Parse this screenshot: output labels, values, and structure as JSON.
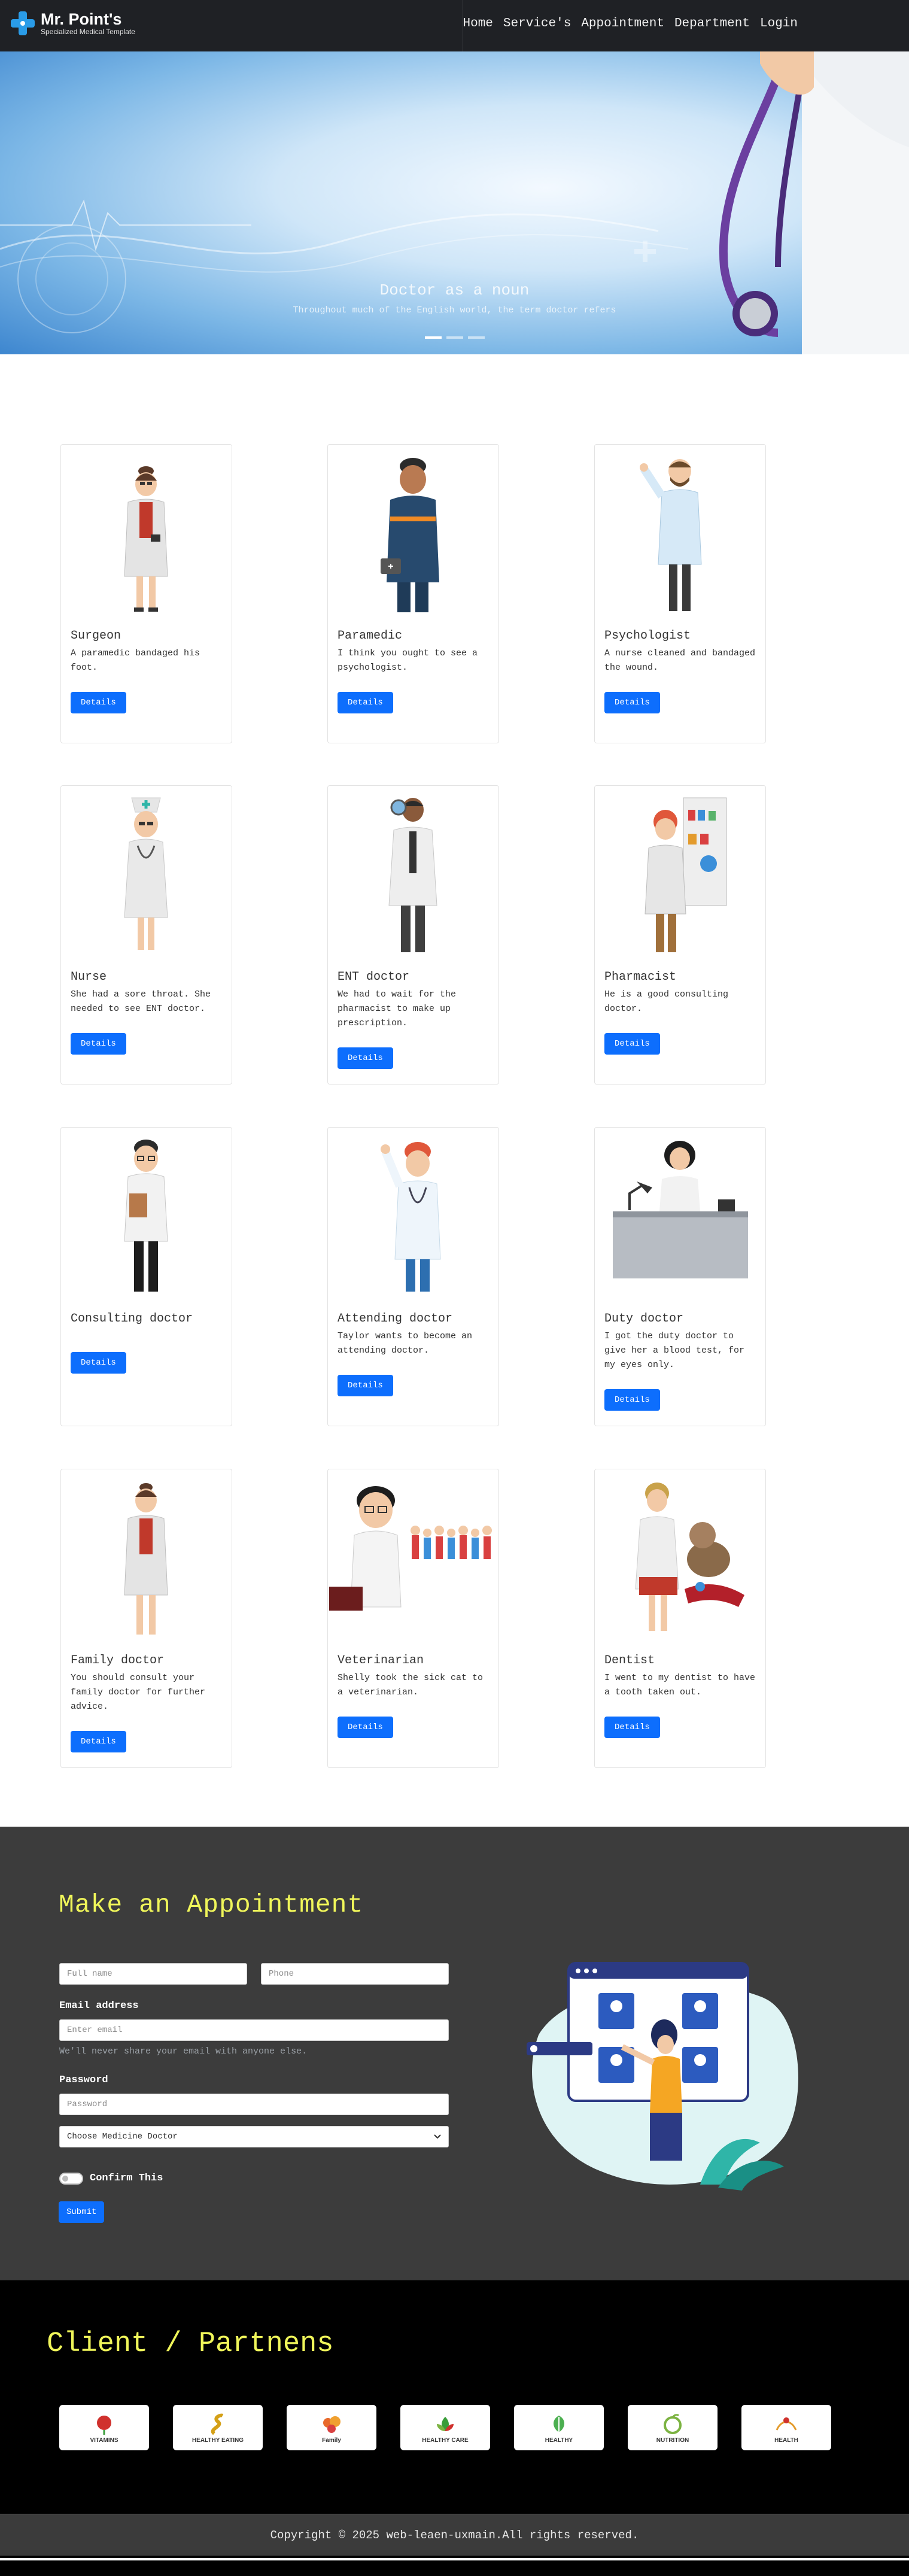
{
  "nav": {
    "brand_title": "Mr. Point's",
    "brand_subtitle": "Specialized Medical Template",
    "links": [
      "Home",
      "Service's",
      "Appointment",
      "Department",
      "Login"
    ]
  },
  "hero": {
    "title": "Doctor as a noun",
    "subtitle": "Throughout much of the English world, the term doctor refers",
    "slide_count": 3,
    "active_slide": 1
  },
  "cards": [
    {
      "title": "Surgeon",
      "text": "A paramedic bandaged his foot.",
      "button": "Details"
    },
    {
      "title": "Paramedic",
      "text": "I think you ought to see a psychologist.",
      "button": "Details"
    },
    {
      "title": "Psychologist",
      "text": "A nurse cleaned and bandaged the wound.",
      "button": "Details"
    },
    {
      "title": "Nurse",
      "text": "She had a sore throat. She needed to see ENT doctor.",
      "button": "Details"
    },
    {
      "title": "ENT doctor",
      "text": "We had to wait for the pharmacist to make up prescription.",
      "button": "Details"
    },
    {
      "title": "Pharmacist",
      "text": "He is a good consulting doctor.",
      "button": "Details"
    },
    {
      "title": "Consulting doctor",
      "text": "",
      "button": "Details"
    },
    {
      "title": "Attending doctor",
      "text": "Taylor wants to become an attending doctor.",
      "button": "Details"
    },
    {
      "title": "Duty doctor",
      "text": "I got the duty doctor to give her a blood test, for my eyes only.",
      "button": "Details"
    },
    {
      "title": "Family doctor",
      "text": "You should consult your family doctor for further advice.",
      "button": "Details"
    },
    {
      "title": "Veterinarian",
      "text": "Shelly took the sick cat to a veterinarian.",
      "button": "Details"
    },
    {
      "title": "Dentist",
      "text": "I went to my dentist to have a tooth taken out.",
      "button": "Details"
    }
  ],
  "appointment": {
    "heading": "Make an Appointment",
    "full_name_placeholder": "Full name",
    "phone_placeholder": "Phone",
    "email_label": "Email address",
    "email_placeholder": "Enter email",
    "email_help": "We'll never share your email with anyone else.",
    "password_label": "Password",
    "password_placeholder": "Password",
    "select_value": "Choose Medicine Doctor",
    "confirm_label": "Confirm This",
    "submit_label": "Submit"
  },
  "clients": {
    "heading": "Client / Partnens",
    "logos": [
      {
        "icon": "rose-logo-icon",
        "text": "VITAMINS",
        "color": "#d0312d"
      },
      {
        "icon": "snake-logo-icon",
        "text": "HEALTHY EATING",
        "color": "#d4a017"
      },
      {
        "icon": "family-logo-icon",
        "text": "Family",
        "color": "#e8692b"
      },
      {
        "icon": "lotus-logo-icon",
        "text": "HEALTHY CARE",
        "color": "#3a9d3a"
      },
      {
        "icon": "leaf-logo-icon",
        "text": "HEALTHY",
        "color": "#4caf50"
      },
      {
        "icon": "apple-logo-icon",
        "text": "NUTRITION",
        "color": "#7cb342"
      },
      {
        "icon": "health-logo-icon",
        "text": "HEALTH",
        "color": "#e39b2d"
      }
    ]
  },
  "footer": {
    "copyright": "Copyright © 2025 web-leaen-uxmain.All rights reserved."
  },
  "colors": {
    "accent_blue": "#0d6efd",
    "heading_yellow": "#f0f65a",
    "nav_bg": "#1f2125",
    "appointment_bg": "#3c3c3c"
  }
}
